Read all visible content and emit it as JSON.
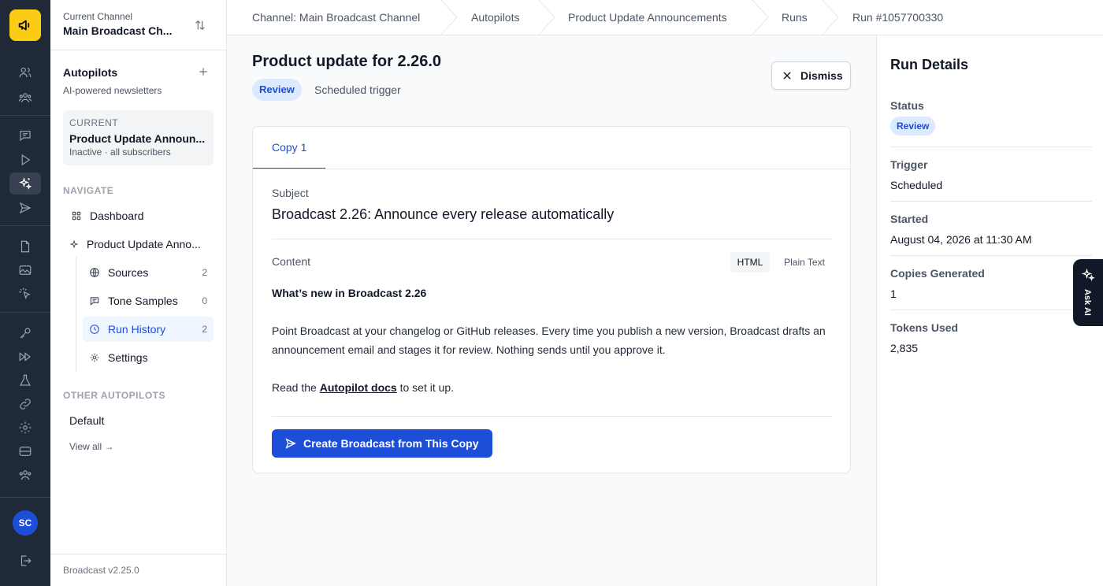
{
  "rail": {
    "logo": "megaphone-icon",
    "items": [
      "users-icon",
      "team-icon",
      "chat-icon",
      "play-icon",
      "sparkles-icon",
      "send-icon",
      "document-icon",
      "image-icon",
      "cursor-click-icon",
      "key-icon",
      "forward-icon",
      "flask-icon",
      "link-icon",
      "gear-icon",
      "database-icon",
      "group-icon"
    ],
    "avatar": "SC",
    "logout": "logout-icon"
  },
  "sidebar": {
    "channel_label": "Current Channel",
    "channel_name": "Main Broadcast Ch...",
    "autopilots_title": "Autopilots",
    "autopilots_subtitle": "AI-powered newsletters",
    "current_label": "CURRENT",
    "current_name": "Product Update Announ...",
    "current_status": "Inactive · all subscribers",
    "navigate_label": "NAVIGATE",
    "nav": {
      "dashboard": "Dashboard",
      "product": "Product Update Anno...",
      "sources": "Sources",
      "sources_count": "2",
      "tone": "Tone Samples",
      "tone_count": "0",
      "runs": "Run History",
      "runs_count": "2",
      "settings": "Settings"
    },
    "other_label": "OTHER AUTOPILOTS",
    "other_default": "Default",
    "view_all": "View all →",
    "version": "Broadcast v2.25.0"
  },
  "breadcrumbs": [
    "Channel: Main Broadcast Channel",
    "Autopilots",
    "Product Update Announcements",
    "Runs",
    "Run #1057700330"
  ],
  "main": {
    "title": "Product update for 2.26.0",
    "status_badge": "Review",
    "trigger": "Scheduled trigger",
    "dismiss": "Dismiss",
    "tab": "Copy 1",
    "subject_label": "Subject",
    "subject": "Broadcast 2.26: Announce every release automatically",
    "content_label": "Content",
    "mode_html": "HTML",
    "mode_plain": "Plain Text",
    "body_heading": "What’s new in Broadcast 2.26",
    "body_p1": "Point Broadcast at your changelog or GitHub releases. Every time you publish a new version, Broadcast drafts an announcement email and stages it for review. Nothing sends until you approve it.",
    "body_p2_pre": "Read the ",
    "body_link": "Autopilot docs",
    "body_p2_post": " to set it up.",
    "create_button": "Create Broadcast from This Copy"
  },
  "run_details": {
    "title": "Run Details",
    "status_label": "Status",
    "status": "Review",
    "trigger_label": "Trigger",
    "trigger": "Scheduled",
    "started_label": "Started",
    "started": "August 04, 2026 at 11:30 AM",
    "copies_label": "Copies Generated",
    "copies": "1",
    "tokens_label": "Tokens Used",
    "tokens": "2,835"
  },
  "ask_ai": "Ask AI",
  "colors": {
    "accent": "#1d4ed8",
    "logo": "#facc15",
    "rail": "#1f2937",
    "button": "#1d4ed8"
  }
}
